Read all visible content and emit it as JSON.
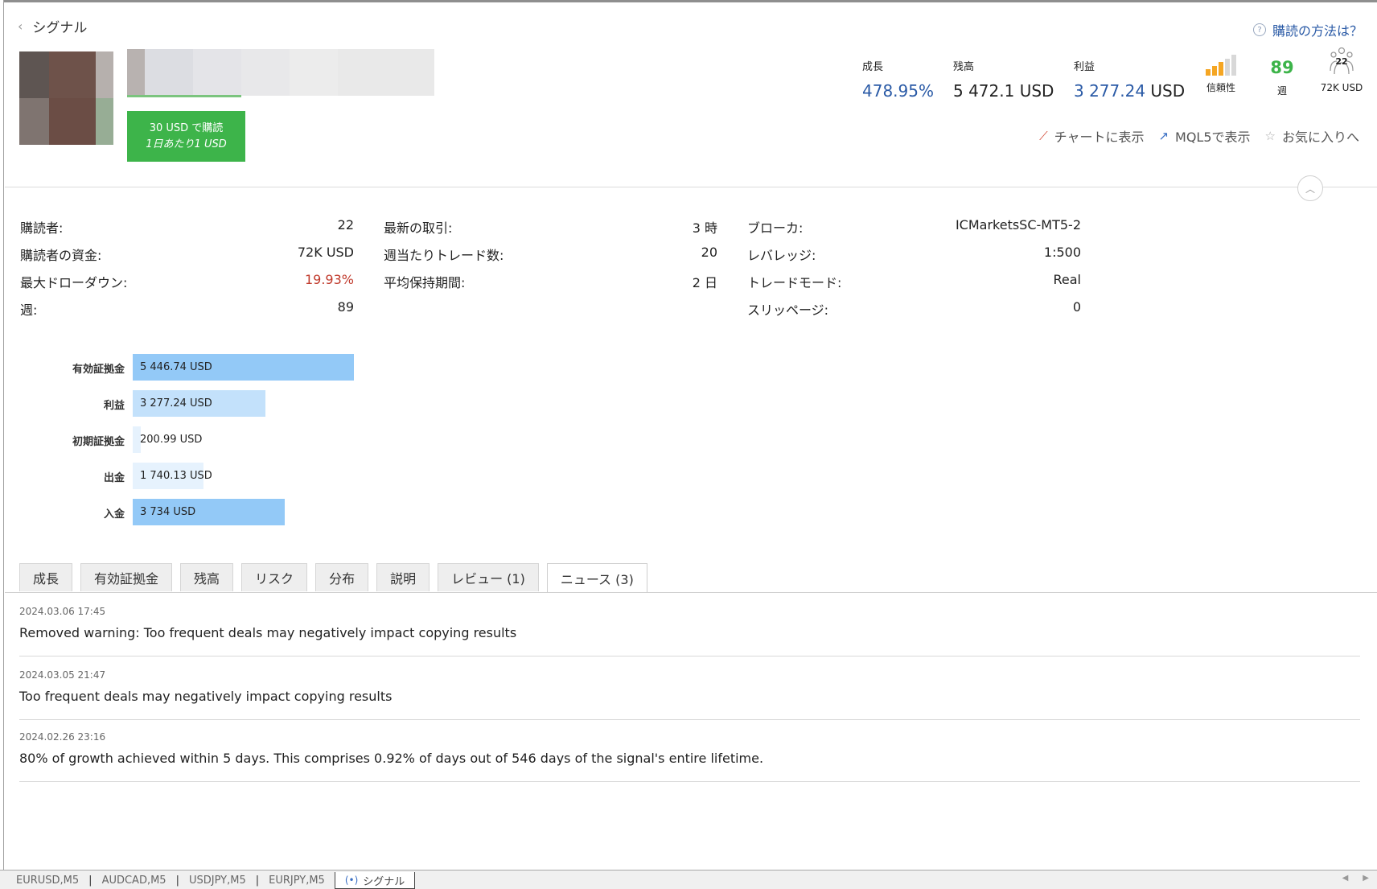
{
  "header": {
    "back_label": "シグナル",
    "howto_label": "購読の方法は？",
    "subscribe_line1": "30 USD で購読",
    "subscribe_line2": "1日あたり1 USD"
  },
  "stats": {
    "growth_label": "成長",
    "growth_value": "478.95%",
    "balance_label": "残高",
    "balance_value": "5 472.1 USD",
    "profit_label": "利益",
    "profit_number": "3 277.24",
    "profit_unit": "USD",
    "reliability_label": "信頼性",
    "reliability_level": 0.6,
    "weeks_value": "89",
    "weeks_label": "週",
    "subscribers_icon_count": "22",
    "subscribers_funds": "72K USD"
  },
  "actions": {
    "show_chart": "チャートに表示",
    "show_mql5": "MQL5で表示",
    "favorite": "お気に入りへ"
  },
  "info": {
    "col1": [
      {
        "label": "購読者:",
        "value": "22"
      },
      {
        "label": "購読者の資金:",
        "value": "72K USD"
      },
      {
        "label": "最大ドローダウン:",
        "value": "19.93%"
      },
      {
        "label": "週:",
        "value": "89"
      }
    ],
    "col2": [
      {
        "label": "最新の取引:",
        "value": "3 時"
      },
      {
        "label": "週当たりトレード数:",
        "value": "20"
      },
      {
        "label": "平均保持期間:",
        "value": "2 日"
      }
    ],
    "col3": [
      {
        "label": "ブローカ:",
        "value": "ICMarketsSC-MT5-2"
      },
      {
        "label": "レバレッジ:",
        "value": "1:500"
      },
      {
        "label": "トレードモード:",
        "value": "Real"
      },
      {
        "label": "スリッページ:",
        "value": "0"
      }
    ]
  },
  "chart_data": {
    "type": "bar",
    "orientation": "horizontal",
    "categories": [
      "有効証拠金",
      "利益",
      "初期証拠金",
      "出金",
      "入金"
    ],
    "values": [
      5446.74,
      3277.24,
      200.99,
      1740.13,
      3734
    ],
    "value_labels": [
      "5 446.74 USD",
      "3 277.24 USD",
      "200.99 USD",
      "1 740.13 USD",
      "3 734 USD"
    ],
    "colors": [
      "#93c9f7",
      "#c3e1fb",
      "#e6f2fd",
      "#e6f2fd",
      "#93c9f7"
    ]
  },
  "tabs": [
    "成長",
    "有効証拠金",
    "残高",
    "リスク",
    "分布",
    "説明",
    "レビュー (1)",
    "ニュース (3)"
  ],
  "active_tab": 7,
  "news": [
    {
      "date": "2024.03.06 17:45",
      "text": "Removed warning: Too frequent deals may negatively impact copying results"
    },
    {
      "date": "2024.03.05 21:47",
      "text": "Too frequent deals may negatively impact copying results"
    },
    {
      "date": "2024.02.26 23:16",
      "text": "80% of growth achieved within 5 days. This comprises 0.92% of days out of 546 days of the signal's entire lifetime."
    }
  ],
  "bottom_tabs": [
    "EURUSD,M5",
    "AUDCAD,M5",
    "USDJPY,M5",
    "EURJPY,M5",
    "シグナル"
  ],
  "colors": {
    "accent_blue": "#2a5aa6",
    "subscribe_green": "#3db44a",
    "drawdown_red": "#c0392b",
    "reliability_orange": "#f5a623"
  }
}
